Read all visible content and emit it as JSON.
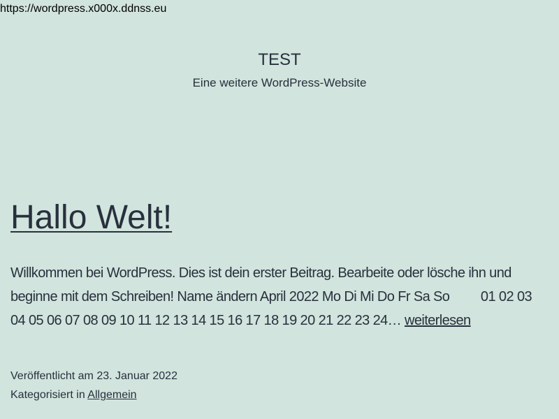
{
  "url": "https://wordpress.x000x.ddnss.eu",
  "site": {
    "title": "TEST",
    "description": "Eine weitere WordPress-Website"
  },
  "post": {
    "title": "Hallo Welt!",
    "excerpt": "Willkommen bei WordPress. Dies ist dein erster Beitrag. Bearbeite oder lösche ihn und beginne mit dem Schreiben! Name ändern April 2022 Mo Di Mi Do Fr Sa So         01 02 03 04 05 06 07 08 09 10 11 12 13 14 15 16 17 18 19 20 21 22 23 24… ",
    "read_more": "weiterlesen",
    "published_label": "Veröffentlicht am 23. Januar 2022",
    "category_label": "Kategorisiert in ",
    "category": "Allgemein"
  },
  "colors": {
    "background": "#d1e4dd",
    "text": "#28303d"
  }
}
